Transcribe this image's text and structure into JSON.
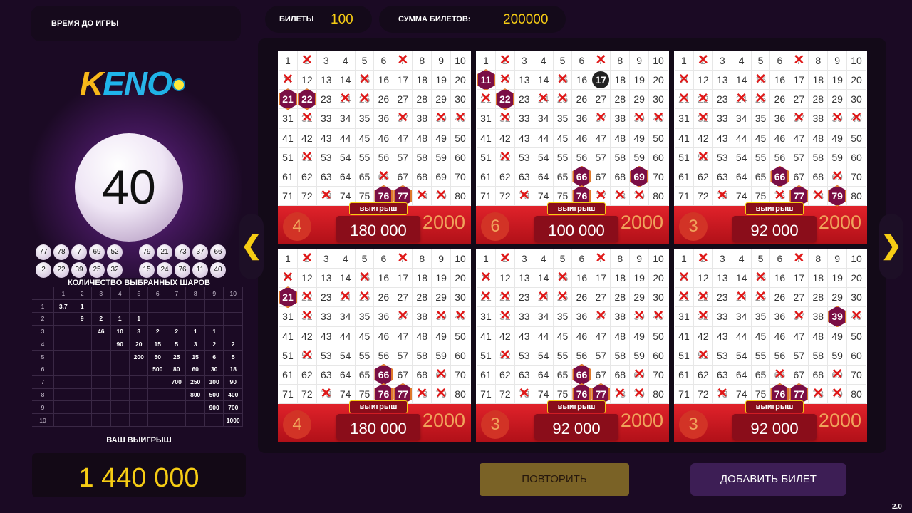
{
  "header": {
    "timer_label": "ВРЕМЯ ДО ИГРЫ",
    "tickets_label": "БИЛЕТЫ",
    "tickets_value": "100",
    "sum_label": "СУММА БИЛЕТОВ:",
    "sum_value": "200000"
  },
  "logo": {
    "k": "K",
    "e": "E",
    "n": "N",
    "o": "O"
  },
  "current_ball": "40",
  "drawn_balls": [
    "77",
    "78",
    "7",
    "69",
    "52",
    "79",
    "21",
    "73",
    "37",
    "66",
    "2",
    "22",
    "39",
    "25",
    "32",
    "15",
    "24",
    "76",
    "11",
    "40"
  ],
  "paytable": {
    "title": "КОЛИЧЕСТВО ВЫБРАННЫХ ШАРОВ",
    "columns": [
      "1",
      "2",
      "3",
      "4",
      "5",
      "6",
      "7",
      "8",
      "9",
      "10"
    ],
    "rows": [
      {
        "hits": "1",
        "values": [
          "3.7",
          "1",
          "",
          "",
          "",
          "",
          "",
          "",
          "",
          ""
        ]
      },
      {
        "hits": "2",
        "values": [
          "",
          "9",
          "2",
          "1",
          "1",
          "",
          "",
          "",
          "",
          ""
        ]
      },
      {
        "hits": "3",
        "values": [
          "",
          "",
          "46",
          "10",
          "3",
          "2",
          "2",
          "1",
          "1",
          ""
        ]
      },
      {
        "hits": "4",
        "values": [
          "",
          "",
          "",
          "90",
          "20",
          "15",
          "5",
          "3",
          "2",
          "2"
        ]
      },
      {
        "hits": "5",
        "values": [
          "",
          "",
          "",
          "",
          "200",
          "50",
          "25",
          "15",
          "6",
          "5"
        ]
      },
      {
        "hits": "6",
        "values": [
          "",
          "",
          "",
          "",
          "",
          "500",
          "80",
          "60",
          "30",
          "18"
        ]
      },
      {
        "hits": "7",
        "values": [
          "",
          "",
          "",
          "",
          "",
          "",
          "700",
          "250",
          "100",
          "90"
        ]
      },
      {
        "hits": "8",
        "values": [
          "",
          "",
          "",
          "",
          "",
          "",
          "",
          "800",
          "500",
          "400"
        ]
      },
      {
        "hits": "9",
        "values": [
          "",
          "",
          "",
          "",
          "",
          "",
          "",
          "",
          "900",
          "700"
        ]
      },
      {
        "hits": "10",
        "values": [
          "",
          "",
          "",
          "",
          "",
          "",
          "",
          "",
          "",
          "1000"
        ]
      }
    ]
  },
  "win": {
    "label": "ВАШ ВЫИГРЫШ",
    "value": "1 440 000"
  },
  "tickets": [
    {
      "crossed": [
        2,
        7,
        11,
        15,
        24,
        25,
        32,
        37,
        39,
        40,
        52,
        66,
        73,
        78,
        79
      ],
      "highlight": [
        21,
        22,
        76,
        77
      ],
      "dark": [],
      "hits": "4",
      "win_label": "выигрыш",
      "win": "180 000",
      "stake": "2000"
    },
    {
      "crossed": [
        2,
        7,
        12,
        15,
        21,
        24,
        25,
        32,
        37,
        39,
        40,
        52,
        73,
        77,
        78,
        79
      ],
      "highlight": [
        11,
        22,
        66,
        69,
        76
      ],
      "dark": [
        17
      ],
      "hits": "6",
      "win_label": "выигрыш",
      "win": "100 000",
      "stake": "2000"
    },
    {
      "crossed": [
        2,
        7,
        11,
        15,
        21,
        22,
        24,
        25,
        32,
        37,
        39,
        40,
        52,
        69,
        73,
        76,
        78
      ],
      "highlight": [
        66,
        77,
        79
      ],
      "dark": [],
      "hits": "3",
      "win_label": "выигрыш",
      "win": "92 000",
      "stake": "2000"
    },
    {
      "crossed": [
        2,
        7,
        11,
        15,
        22,
        24,
        25,
        32,
        37,
        39,
        40,
        52,
        69,
        73,
        78,
        79
      ],
      "highlight": [
        21,
        66,
        76,
        77
      ],
      "dark": [],
      "hits": "4",
      "win_label": "выигрыш",
      "win": "180 000",
      "stake": "2000"
    },
    {
      "crossed": [
        2,
        7,
        11,
        15,
        21,
        22,
        24,
        25,
        32,
        37,
        39,
        40,
        52,
        69,
        73,
        78,
        79
      ],
      "highlight": [
        66,
        76,
        77
      ],
      "dark": [],
      "hits": "3",
      "win_label": "выигрыш",
      "win": "92 000",
      "stake": "2000"
    },
    {
      "crossed": [
        2,
        7,
        11,
        15,
        21,
        22,
        24,
        25,
        32,
        37,
        40,
        52,
        66,
        69,
        73,
        78,
        79
      ],
      "highlight": [
        39,
        76,
        77
      ],
      "dark": [],
      "hits": "3",
      "win_label": "выигрыш",
      "win": "92 000",
      "stake": "2000"
    }
  ],
  "buttons": {
    "repeat": "ПОВТОРИТЬ",
    "add": "ДОБАВИТЬ БИЛЕТ",
    "prev": "❮",
    "next": "❯"
  },
  "version": "2.0",
  "colors": {
    "accent": "#f6cc14",
    "ticket_footer": "#e0222a",
    "highlight": "#7a0e45",
    "cross": "#e01818"
  }
}
